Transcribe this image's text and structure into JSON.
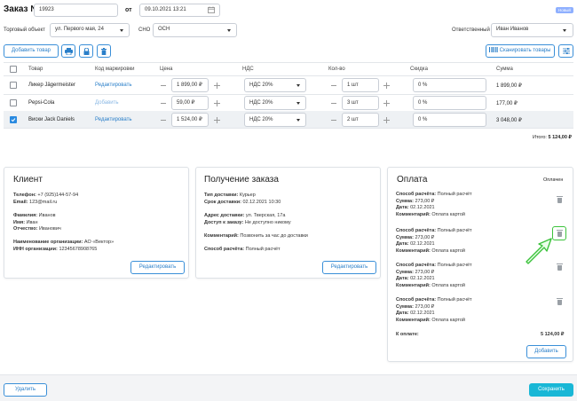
{
  "header": {
    "order_label": "Заказ №",
    "order_number": "19923",
    "date_from_label": "от",
    "date_value": "09.10.2021 13:21",
    "status_badge": "Новый"
  },
  "filters": {
    "shop_label": "Торговый объект",
    "shop_value": "ул. Первого мая, 24",
    "tax_label": "СНО",
    "tax_value": "ОСН",
    "responsible_label": "Ответственный",
    "responsible_value": "Иван Иванов"
  },
  "toolbar": {
    "add_product_label": "Добавить товар",
    "scan_label": "Сканировать товары",
    "icons": [
      "printer-icon",
      "lock-icon",
      "trash-icon",
      "barcode-icon",
      "settings-sliders-icon"
    ]
  },
  "table": {
    "headers": [
      "Товар",
      "Код маркировки",
      "Цена",
      "НДС",
      "Кол-во",
      "Скидка",
      "Сумма"
    ],
    "rows": [
      {
        "name": "Ликер Jägermeister",
        "mark": "Редактировать",
        "price": "1 899,00 ₽",
        "vat": "НДС 20%",
        "qty": "1 шт",
        "discount": "0 %",
        "sum": "1 899,00 ₽",
        "checked": false
      },
      {
        "name": "Pepsi-Cola",
        "mark": "Добавить",
        "price": "59,00 ₽",
        "vat": "НДС 20%",
        "qty": "3 шт",
        "discount": "0 %",
        "sum": "177,00 ₽",
        "checked": false
      },
      {
        "name": "Виски Jack Daniels",
        "mark": "Редактировать",
        "price": "1 524,00 ₽",
        "vat": "НДС 20%",
        "qty": "2 шт",
        "discount": "0 %",
        "sum": "3 048,00 ₽",
        "checked": true
      }
    ],
    "total_label": "Итого:",
    "total_value": "5 124,00 ₽"
  },
  "client": {
    "title": "Клиент",
    "phone_label": "Телефон:",
    "phone": "+7 (925)144-57-94",
    "email_label": "Email:",
    "email": "123@mail.ru",
    "last_name_label": "Фамилия:",
    "last_name": "Иванов",
    "first_name_label": "Имя:",
    "first_name": "Иван",
    "patronymic_label": "Отчество:",
    "patronymic": "Иванович",
    "org_label": "Наименование организации:",
    "org": "АО «Вектор»",
    "inn_label": "ИНН организации:",
    "inn": "12345678908765",
    "edit_label": "Редактировать"
  },
  "delivery": {
    "title": "Получение заказа",
    "type_label": "Тип доставки:",
    "type": "Курьер",
    "term_label": "Срок доставки:",
    "term": "02.12.2021 10:30",
    "address_label": "Адрес доставки:",
    "address": "ул. Тверская, 17а",
    "access_label": "Доступ к заказу:",
    "access": "Не доступно никому",
    "comment_label": "Комментарий:",
    "comment": "Позвонить за час до доставки",
    "method_label": "Способ расчёта:",
    "method": "Полный расчёт",
    "edit_label": "Редактировать"
  },
  "payment": {
    "title": "Оплата",
    "status": "Оплачен",
    "entries": [
      {
        "method_label": "Способ расчёта:",
        "method": "Полный расчёт",
        "sum_label": "Сумма:",
        "sum": "273,00 ₽",
        "date_label": "Дата:",
        "date": "02.12.2021",
        "comment_label": "Комментарий:",
        "comment": "Оплата картой"
      },
      {
        "method_label": "Способ расчёта:",
        "method": "Полный расчёт",
        "sum_label": "Сумма:",
        "sum": "273,00 ₽",
        "date_label": "Дата:",
        "date": "02.12.2021",
        "comment_label": "Комментарий:",
        "comment": "Оплата картой"
      },
      {
        "method_label": "Способ расчёта:",
        "method": "Полный расчёт",
        "sum_label": "Сумма:",
        "sum": "273,00 ₽",
        "date_label": "Дата:",
        "date": "02.12.2021",
        "comment_label": "Комментарий:",
        "comment": "Оплата картой"
      },
      {
        "method_label": "Способ расчёта:",
        "method": "Полный расчёт",
        "sum_label": "Сумма:",
        "sum": "273,00 ₽",
        "date_label": "Дата:",
        "date": "02.12.2021",
        "comment_label": "Комментарий:",
        "comment": "Оплата картой"
      }
    ],
    "to_pay_label": "К оплате:",
    "to_pay_value": "5 124,00 ₽",
    "add_label": "Добавить"
  },
  "footer": {
    "delete_label": "Удалить",
    "save_label": "Сохранить"
  },
  "colors": {
    "accent": "#2a8ae0",
    "save_button": "#19b7d6",
    "highlight_arrow": "#3cc23c",
    "status_badge": "#8fb0ff"
  }
}
